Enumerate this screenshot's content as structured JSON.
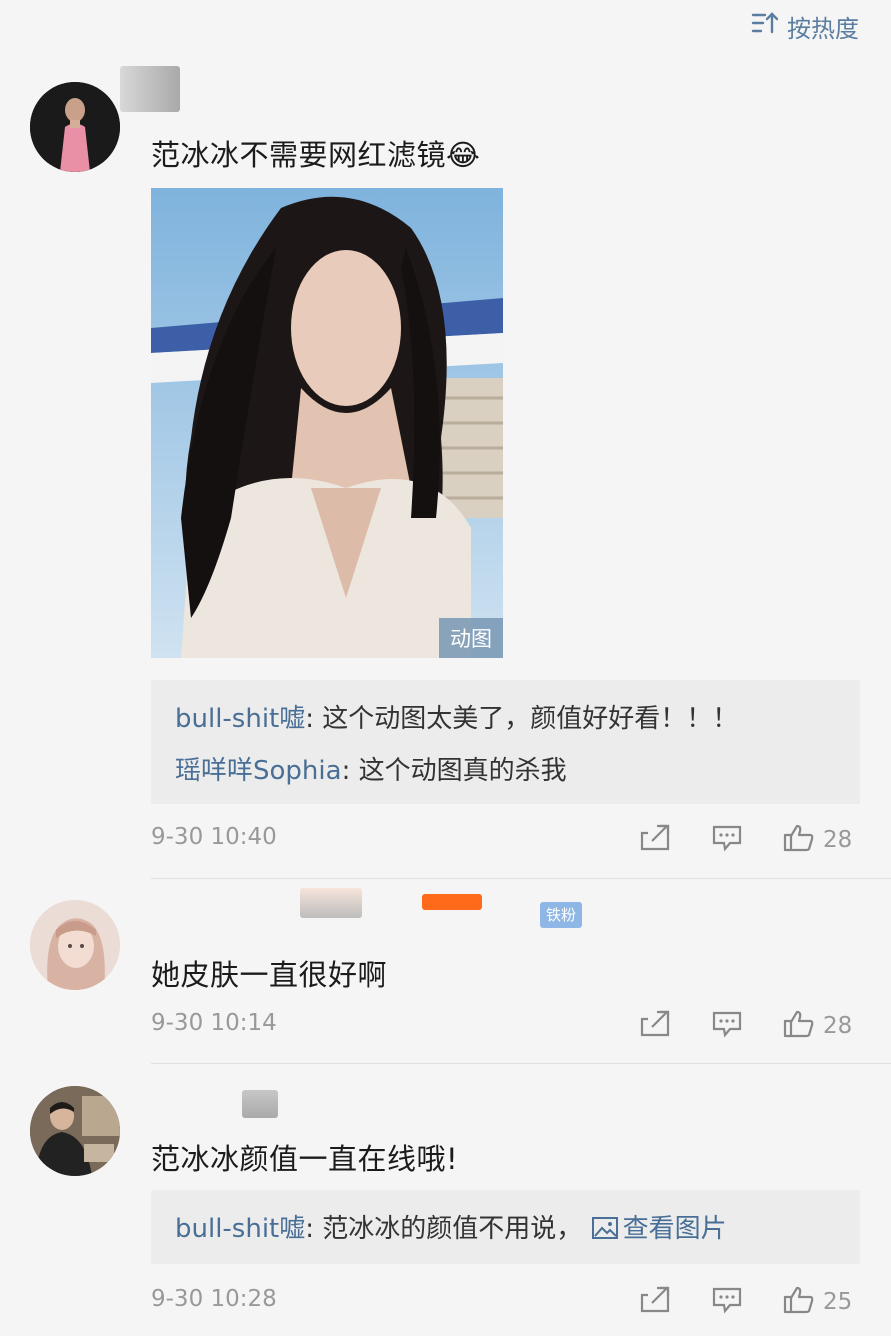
{
  "sort": {
    "label": "按热度",
    "icon": "sort-icon"
  },
  "comments": [
    {
      "text": "范冰冰不需要网红滤镜😂",
      "media_badge": "动图",
      "replies": [
        {
          "user": "bull-shit嘘",
          "text": ": 这个动图太美了，颜值好好看！！！"
        },
        {
          "user": "瑶咩咩Sophia",
          "text": ": 这个动图真的杀我"
        }
      ],
      "time": "9-30 10:40",
      "likes": "28"
    },
    {
      "badge": "铁粉",
      "text": "她皮肤一直很好啊",
      "time": "9-30 10:14",
      "likes": "28"
    },
    {
      "text": "范冰冰颜值一直在线哦!",
      "replies": [
        {
          "user": "bull-shit嘘",
          "text": ": 范冰冰的颜值不用说，",
          "link": "查看图片"
        }
      ],
      "time": "9-30 10:28",
      "likes": "25"
    }
  ],
  "colors": {
    "link": "#4a6f96",
    "meta": "#999999",
    "background": "#f5f5f5",
    "reply_bg": "#ececec"
  }
}
